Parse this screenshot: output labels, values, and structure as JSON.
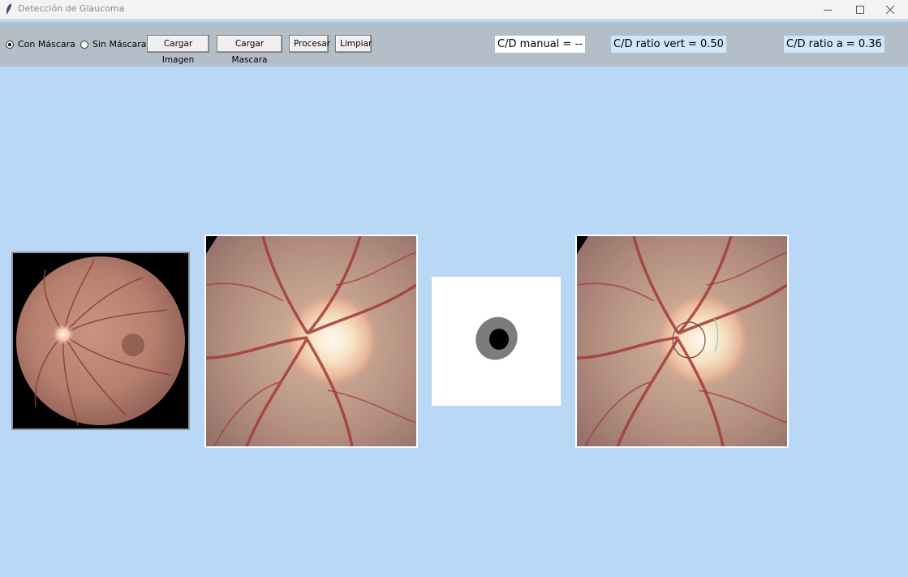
{
  "window": {
    "title": "Detección de Glaucoma"
  },
  "toolbar": {
    "mask_options": [
      {
        "label": "Con Máscara",
        "selected": true
      },
      {
        "label": "Sin Máscara",
        "selected": false
      }
    ],
    "buttons": {
      "load_image": "Cargar Imagen",
      "load_mask": "Cargar Mascara",
      "process": "Procesar",
      "clear": "Limpiar"
    },
    "stats": {
      "manual": "C/D manual = --",
      "vertical": "C/D ratio vert = 0.50",
      "area": "C/D ratio a = 0.36"
    }
  },
  "colors": {
    "background": "#b9d8f5",
    "toolbar": "#b3bec8",
    "stat_manual_bg": "#ffffff",
    "stat_highlight_bg": "#cfe6fb"
  }
}
